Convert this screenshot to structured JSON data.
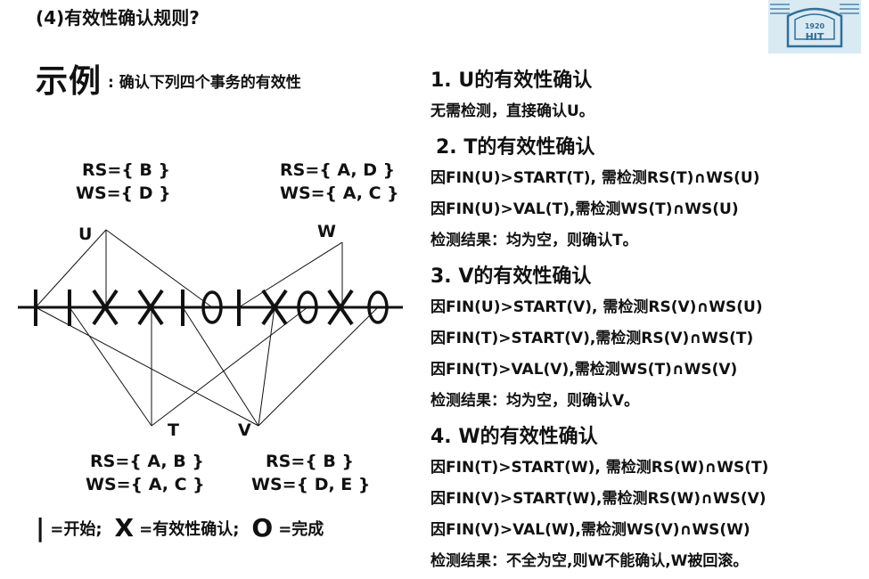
{
  "title": "(4)有效性确认规则?",
  "logo": {
    "year": "1920",
    "abbr": "HIT"
  },
  "example": {
    "big": "示例",
    "small": ": 确认下列四个事务的有效性"
  },
  "transactions": {
    "U": {
      "label": "U",
      "rs": "RS={ B }",
      "ws": "WS={ D }"
    },
    "W": {
      "label": "W",
      "rs": "RS={ A, D }",
      "ws": "WS={ A, C }"
    },
    "T": {
      "label": "T",
      "rs": "RS={ A, B }",
      "ws": "WS={ A, C }"
    },
    "V": {
      "label": "V",
      "rs": "RS={ B }",
      "ws": "WS={ D, E }"
    }
  },
  "legend": {
    "start_symbol": "|",
    "start_text": "=开始;",
    "validate_symbol": "X",
    "validate_text": "=有效性确认;",
    "finish_symbol": "O",
    "finish_text": "=完成"
  },
  "sections": [
    {
      "heading": "1. U的有效性确认",
      "lines": [
        "无需检测，直接确认U。"
      ]
    },
    {
      "heading": "2. T的有效性确认",
      "lines": [
        "因FIN(U)>START(T), 需检测RS(T)∩WS(U)",
        "因FIN(U)>VAL(T),需检测WS(T)∩WS(U)",
        "检测结果：均为空，则确认T。"
      ]
    },
    {
      "heading": "3. V的有效性确认",
      "lines": [
        "因FIN(U)>START(V), 需检测RS(V)∩WS(U)",
        "因FIN(T)>START(V),需检测RS(V)∩WS(T)",
        "因FIN(T)>VAL(V),需检测WS(T)∩WS(V)",
        "检测结果：均为空，则确认V。"
      ]
    },
    {
      "heading": "4. W的有效性确认",
      "lines": [
        "因FIN(T)>START(W), 需检测RS(W)∩WS(T)",
        "因FIN(V)>START(W),需检测RS(W)∩WS(V)",
        "因FIN(V)>VAL(W),需检测WS(V)∩WS(W)",
        "检测结果：不全为空,则W不能确认,W被回滚。"
      ]
    }
  ]
}
